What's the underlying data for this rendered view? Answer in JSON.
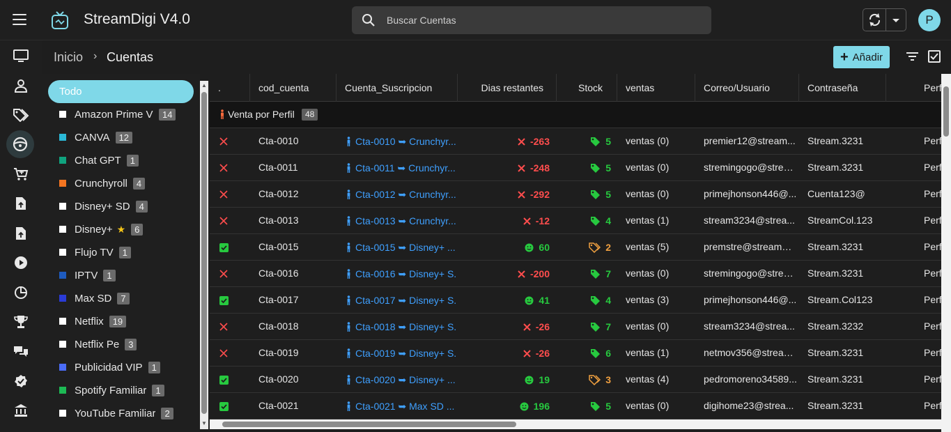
{
  "app": {
    "title": "StreamDigi V4.0",
    "avatar_letter": "P"
  },
  "search": {
    "placeholder": "Buscar Cuentas"
  },
  "breadcrumb": {
    "home": "Inicio",
    "separator": "›",
    "current": "Cuentas"
  },
  "toolbar": {
    "add_label": "Añadir"
  },
  "rail_icons": [
    "monitor-icon",
    "user-icon",
    "tags-icon",
    "steering-wheel-icon",
    "cart-icon",
    "file-upload-icon",
    "file-upload-icon",
    "play-circle-icon",
    "pie-chart-icon",
    "trophy-icon",
    "chat-icon",
    "verified-badge-icon",
    "bank-icon"
  ],
  "categories": {
    "all_label": "Todo",
    "items": [
      {
        "name": "Amazon Prime Vi",
        "count": "14",
        "color": "#ffffff"
      },
      {
        "name": "CANVA",
        "count": "12",
        "color": "#2bb8d6"
      },
      {
        "name": "Chat GPT",
        "count": "1",
        "color": "#10a37f"
      },
      {
        "name": "Crunchyroll",
        "count": "4",
        "color": "#f47521"
      },
      {
        "name": "Disney+ SD",
        "count": "4",
        "color": "#ffffff"
      },
      {
        "name": "Disney+",
        "count": "6",
        "color": "#ffffff",
        "star": "★"
      },
      {
        "name": "Flujo TV",
        "count": "1",
        "color": "#ffffff"
      },
      {
        "name": "IPTV",
        "count": "1",
        "color": "#1e5bbf"
      },
      {
        "name": "Max SD",
        "count": "7",
        "color": "#2a3bd6"
      },
      {
        "name": "Netflix",
        "count": "19",
        "color": "#ffffff"
      },
      {
        "name": "Netflix Pe",
        "count": "3",
        "color": "#ffffff"
      },
      {
        "name": "Publicidad VIP",
        "count": "1",
        "color": "#4a6cf7"
      },
      {
        "name": "Spotify Familiar",
        "count": "1",
        "color": "#1db954"
      },
      {
        "name": "YouTube Familiar",
        "count": "2",
        "color": "#ffffff"
      }
    ]
  },
  "table": {
    "headers": [
      ".",
      "cod_cuenta",
      "Cuenta_Suscripcion",
      "Dias restantes",
      "Stock",
      "ventas",
      "Correo/Usuario",
      "Contraseña",
      "Perfil"
    ],
    "group": {
      "label": "Venta por Perfil",
      "count": "48"
    },
    "rows": [
      {
        "status": "x",
        "cod": "Cta-0010",
        "sus": "Cta-0010 ➥ Crunchyr...",
        "dias": "-263",
        "dias_state": "bad",
        "stock": "5",
        "stock_state": "ok",
        "ventas": "ventas (0)",
        "correo": "premier12@stream...",
        "pass": "Stream.3231",
        "perf": "Perfil"
      },
      {
        "status": "x",
        "cod": "Cta-0011",
        "sus": "Cta-0011 ➥ Crunchyr...",
        "dias": "-248",
        "dias_state": "bad",
        "stock": "5",
        "stock_state": "ok",
        "ventas": "ventas (0)",
        "correo": "stremingogo@strea...",
        "pass": "Stream.3231",
        "perf": "Perfil"
      },
      {
        "status": "x",
        "cod": "Cta-0012",
        "sus": "Cta-0012 ➥ Crunchyr...",
        "dias": "-292",
        "dias_state": "bad",
        "stock": "5",
        "stock_state": "ok",
        "ventas": "ventas (0)",
        "correo": "primejhonson446@...",
        "pass": "Cuenta123@",
        "perf": "Perfil"
      },
      {
        "status": "x",
        "cod": "Cta-0013",
        "sus": "Cta-0013 ➥ Crunchyr...",
        "dias": "-12",
        "dias_state": "bad",
        "stock": "4",
        "stock_state": "ok",
        "ventas": "ventas (1)",
        "correo": "stream3234@strea...",
        "pass": "StreamCol.123",
        "perf": "Perfil"
      },
      {
        "status": "ok",
        "cod": "Cta-0015",
        "sus": "Cta-0015 ➥ Disney+ ...",
        "dias": "60",
        "dias_state": "good",
        "stock": "2",
        "stock_state": "low",
        "ventas": "ventas (5)",
        "correo": "premstre@streamdi...",
        "pass": "Stream.3231",
        "perf": "Perfil"
      },
      {
        "status": "x",
        "cod": "Cta-0016",
        "sus": "Cta-0016 ➥ Disney+ S...",
        "dias": "-200",
        "dias_state": "bad",
        "stock": "7",
        "stock_state": "ok",
        "ventas": "ventas (0)",
        "correo": "stremingogo@strea...",
        "pass": "Stream.3231",
        "perf": "Perfil"
      },
      {
        "status": "ok",
        "cod": "Cta-0017",
        "sus": "Cta-0017 ➥ Disney+ S...",
        "dias": "41",
        "dias_state": "good",
        "stock": "4",
        "stock_state": "ok",
        "ventas": "ventas (3)",
        "correo": "primejhonson446@...",
        "pass": "Stream.Col123",
        "perf": "Perfil"
      },
      {
        "status": "x",
        "cod": "Cta-0018",
        "sus": "Cta-0018 ➥ Disney+ S...",
        "dias": "-26",
        "dias_state": "bad",
        "stock": "7",
        "stock_state": "ok",
        "ventas": "ventas (0)",
        "correo": "stream3234@strea...",
        "pass": "Stream.3232",
        "perf": "Perfil"
      },
      {
        "status": "x",
        "cod": "Cta-0019",
        "sus": "Cta-0019 ➥ Disney+ S...",
        "dias": "-26",
        "dias_state": "bad",
        "stock": "6",
        "stock_state": "ok",
        "ventas": "ventas (1)",
        "correo": "netmov356@stream...",
        "pass": "Stream.3231",
        "perf": "Perfil"
      },
      {
        "status": "ok",
        "cod": "Cta-0020",
        "sus": "Cta-0020 ➥ Disney+ ...",
        "dias": "19",
        "dias_state": "good",
        "stock": "3",
        "stock_state": "low",
        "ventas": "ventas (4)",
        "correo": "pedromoreno34589...",
        "pass": "Stream.3231",
        "perf": "Perfil"
      },
      {
        "status": "ok",
        "cod": "Cta-0021",
        "sus": "Cta-0021 ➥ Max SD ...",
        "dias": "196",
        "dias_state": "good",
        "stock": "5",
        "stock_state": "ok",
        "ventas": "ventas (0)",
        "correo": "digihome23@strea...",
        "pass": "Stream.3231",
        "perf": "Perfil"
      }
    ]
  },
  "colors": {
    "accent": "#7fd8e8",
    "link": "#3fa0ff",
    "bad": "#ff4d4d",
    "good": "#27c93f",
    "low_stock": "#f0a040"
  }
}
